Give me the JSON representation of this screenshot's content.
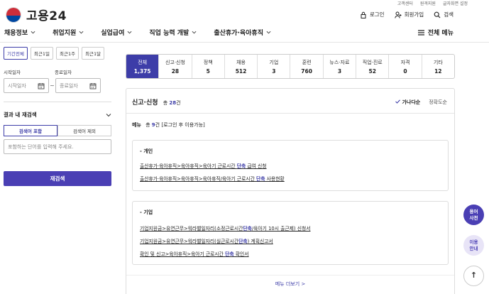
{
  "header": {
    "logo_text": "고용24",
    "util_links": [
      "고객센터",
      "원격지원",
      "글자화면 설정"
    ],
    "actions": [
      {
        "label": "로그인",
        "icon": "lock-icon"
      },
      {
        "label": "회원가입",
        "icon": "user-plus-icon"
      },
      {
        "label": "검색",
        "icon": "search-icon"
      }
    ],
    "gnb": [
      "채용정보",
      "취업지원",
      "실업급여",
      "직업 능력 개발",
      "출산휴가·육아휴직"
    ],
    "all_menu": "전체 메뉴"
  },
  "filters": {
    "periods": [
      "기간전체",
      "최근1일",
      "최근1주",
      "최근1달"
    ],
    "active_period": "기간전체",
    "start_label": "시작일자",
    "end_label": "종료일자",
    "start_placeholder": "시작일자",
    "end_placeholder": "종료일자",
    "date_separator": "~",
    "refine_title": "결과 내 재검색",
    "include_label": "검색어 포함",
    "exclude_label": "검색어 제외",
    "keyword_placeholder": "포함하는 단어를 입력해 주세요.",
    "search_button": "재검색"
  },
  "categories": [
    {
      "label": "전체",
      "count": "1,375",
      "active": true
    },
    {
      "label": "신고·신청",
      "count": "28"
    },
    {
      "label": "정책",
      "count": "5"
    },
    {
      "label": "채용",
      "count": "512"
    },
    {
      "label": "기업",
      "count": "3"
    },
    {
      "label": "훈련",
      "count": "760"
    },
    {
      "label": "뉴스·자료",
      "count": "3"
    },
    {
      "label": "직업·진로",
      "count": "52"
    },
    {
      "label": "자격",
      "count": "0"
    },
    {
      "label": "기타",
      "count": "12"
    }
  ],
  "section": {
    "title": "신고·신청",
    "total_prefix": "총 ",
    "total_count": "28",
    "total_suffix": "건",
    "sorts": [
      "가나다순",
      "정확도순"
    ],
    "active_sort": "가나다순",
    "menu_label": "메뉴",
    "menu_prefix": "총 ",
    "menu_count": "9",
    "menu_suffix": "건 [로그인 후 이용가능]",
    "groups": [
      {
        "title": "- 개인",
        "links": [
          {
            "before": "출산휴가·육아휴직>육아휴직>육아기 근로시간 ",
            "hl": "단축",
            "after": " 급여 신청"
          },
          {
            "before": "출산휴가·육아휴직>육아휴직>육아휴직/육아기 근로시간 ",
            "hl": "단축",
            "after": " 사용현황"
          }
        ]
      },
      {
        "title": "- 기업",
        "links": [
          {
            "before": "기업지원금>유연근무>워라밸일자리(소정근로시간",
            "hl": "단축",
            "after": "/육아기 10시 출근제) 신청서"
          },
          {
            "before": "기업지원금>유연근무>워라밸일자리(실근로시간",
            "hl": "단축",
            "after": ") 계획신고서"
          },
          {
            "before": "확인 및 신고>육아휴직>육아기 근로시간 ",
            "hl": "단축",
            "after": " 확인서"
          }
        ]
      }
    ],
    "more_label": "메뉴 더보기 >"
  },
  "floating": {
    "glossary": "용어\n사전",
    "guide": "이용\n안내",
    "top": "↑"
  },
  "colors": {
    "accent": "#3d3da8",
    "button": "#4a3fb4",
    "emblem_red": "#cd2e3a",
    "emblem_blue": "#0047a0"
  }
}
